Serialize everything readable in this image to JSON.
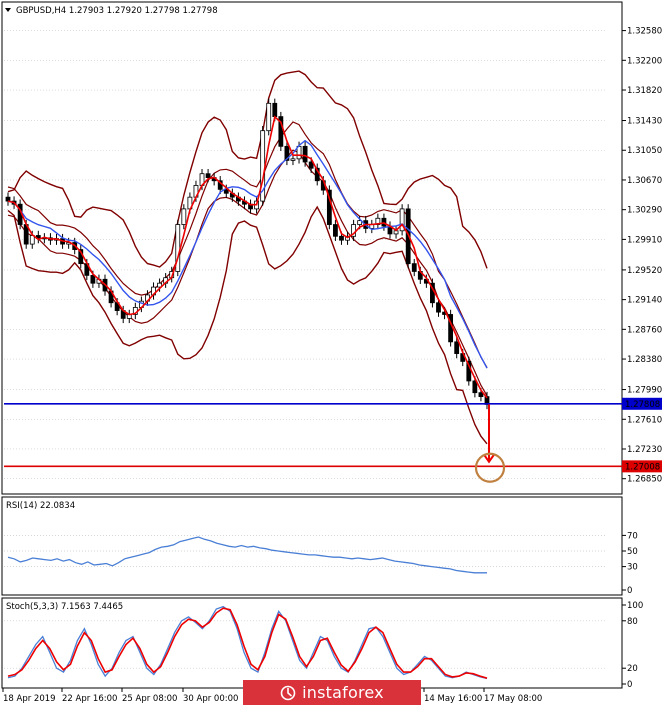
{
  "chart_data": {
    "type": "candlestick",
    "header": "GBPUSD,H4  1.27903 1.27920 1.27798 1.27798",
    "main": {
      "ylim": [
        1.2668,
        1.3292
      ],
      "y_ticks": [
        "1.32580",
        "1.32200",
        "1.31820",
        "1.31430",
        "1.31050",
        "1.30670",
        "1.30290",
        "1.29910",
        "1.29520",
        "1.29140",
        "1.28760",
        "1.28380",
        "1.27990",
        "1.27610",
        "1.27230",
        "1.26850"
      ],
      "price_levels": [
        {
          "value": 1.27808,
          "label": "1.27808",
          "color": "#0000cc"
        },
        {
          "value": 1.27008,
          "label": "1.27008",
          "color": "#dd0000"
        }
      ],
      "forecast_arrow": {
        "from": 1.278,
        "to": 1.2708
      },
      "target_circle": {
        "value": 1.2699
      },
      "close_series": [
        1.304,
        1.3036,
        1.301,
        1.2985,
        1.2996,
        1.2992,
        1.2993,
        1.299,
        1.2992,
        1.2985,
        1.2987,
        1.2978,
        1.296,
        1.2945,
        1.2935,
        1.294,
        1.2925,
        1.291,
        1.29,
        1.289,
        1.2895,
        1.2904,
        1.2912,
        1.292,
        1.293,
        1.2935,
        1.2942,
        1.295,
        1.301,
        1.303,
        1.3045,
        1.306,
        1.3075,
        1.307,
        1.3066,
        1.3055,
        1.305,
        1.3045,
        1.304,
        1.3036,
        1.303,
        1.304,
        1.313,
        1.3165,
        1.3148,
        1.311,
        1.3092,
        1.3094,
        1.311,
        1.309,
        1.3082,
        1.3066,
        1.3054,
        1.301,
        1.2995,
        1.299,
        1.2995,
        1.301,
        1.3015,
        1.3005,
        1.301,
        1.3018,
        1.3008,
        1.2998,
        1.3002,
        1.303,
        1.296,
        1.295,
        1.294,
        1.2935,
        1.291,
        1.2898,
        1.2895,
        1.286,
        1.2845,
        1.2835,
        1.281,
        1.2795,
        1.279,
        1.278
      ]
    },
    "rsi": {
      "label": "RSI(14) 22.0834",
      "levels": [
        70,
        50,
        30
      ],
      "ylim": [
        0,
        100
      ],
      "y_ticks": [
        "70",
        "50",
        "30",
        "0"
      ],
      "values": [
        42,
        40,
        36,
        38,
        41,
        40,
        39,
        38,
        40,
        37,
        39,
        35,
        33,
        36,
        32,
        33,
        34,
        31,
        35,
        40,
        42,
        44,
        46,
        48,
        52,
        55,
        56,
        58,
        62,
        64,
        66,
        68,
        65,
        63,
        60,
        58,
        56,
        55,
        57,
        55,
        56,
        54,
        53,
        51,
        50,
        49,
        48,
        47,
        46,
        45,
        45,
        44,
        43,
        42,
        42,
        41,
        40,
        41,
        40,
        39,
        40,
        41,
        39,
        37,
        36,
        35,
        34,
        32,
        31,
        30,
        29,
        28,
        27,
        25,
        24,
        23,
        22,
        22,
        22
      ]
    },
    "stoch": {
      "label": "Stoch(5,3,3) 7.1563 7.4465",
      "levels": [
        80,
        20
      ],
      "ylim": [
        0,
        100
      ],
      "y_ticks": [
        "100",
        "80",
        "20",
        "0"
      ],
      "main_values": [
        8,
        10,
        20,
        35,
        50,
        60,
        40,
        20,
        15,
        30,
        55,
        70,
        50,
        25,
        10,
        20,
        40,
        55,
        60,
        40,
        20,
        12,
        25,
        45,
        65,
        80,
        85,
        78,
        70,
        80,
        95,
        98,
        92,
        70,
        40,
        20,
        15,
        40,
        70,
        92,
        80,
        55,
        30,
        20,
        40,
        60,
        55,
        35,
        20,
        15,
        30,
        50,
        70,
        72,
        60,
        40,
        20,
        12,
        15,
        25,
        35,
        30,
        20,
        10,
        8,
        10,
        15,
        12,
        9,
        7
      ],
      "signal_values": [
        10,
        12,
        18,
        30,
        45,
        55,
        45,
        28,
        18,
        25,
        48,
        65,
        55,
        32,
        15,
        18,
        35,
        50,
        58,
        45,
        25,
        15,
        22,
        40,
        60,
        75,
        82,
        80,
        72,
        78,
        90,
        96,
        94,
        75,
        48,
        25,
        18,
        35,
        65,
        88,
        82,
        60,
        35,
        22,
        35,
        55,
        58,
        40,
        24,
        16,
        28,
        45,
        65,
        72,
        65,
        45,
        25,
        15,
        15,
        22,
        32,
        32,
        22,
        12,
        9,
        10,
        14,
        13,
        10,
        7.4
      ]
    },
    "x_tick_labels": [
      "18 Apr 2019",
      "22 Apr 16:00",
      "25 Apr 08:00",
      "30 Apr 00:00",
      "14 May 16:00",
      "17 May 08:00"
    ],
    "colors": {
      "bands": "#800000",
      "ma_fast": "#ee0000",
      "ma_slow": "#3355ee",
      "candle": "#000000",
      "osc_line": "#4a7fd6",
      "signal_line": "#ee0000",
      "grid": "#c8c8c8"
    }
  },
  "watermark": {
    "text": "instaforex"
  }
}
